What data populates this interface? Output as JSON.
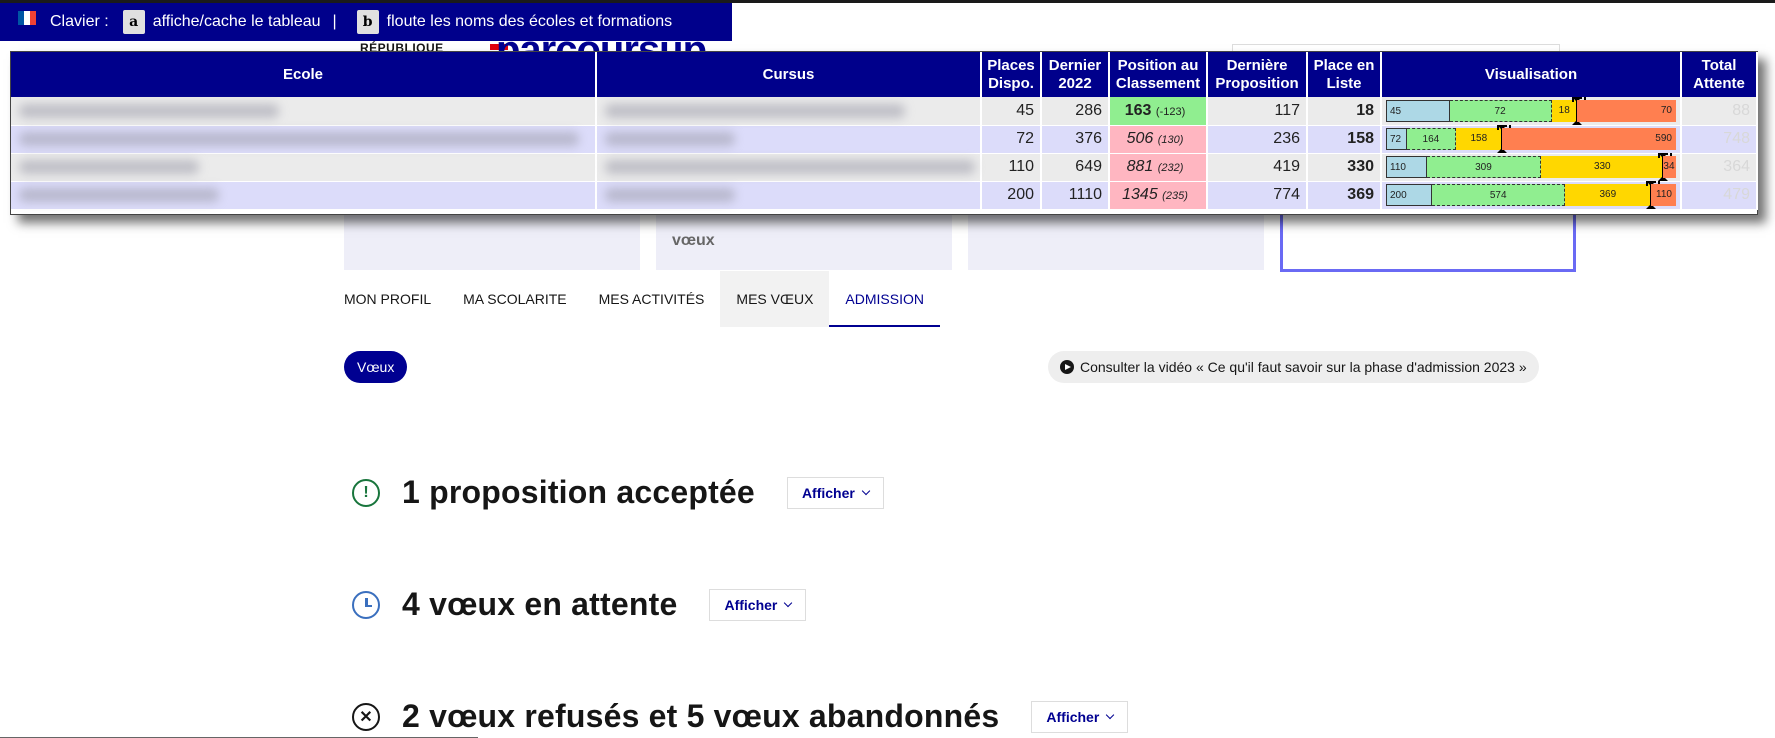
{
  "keyboard_bar": {
    "label": "Clavier :",
    "key_a": "a",
    "key_a_desc": "affiche/cache le tableau",
    "separator": "|",
    "key_b": "b",
    "key_b_desc": "floute les noms des écoles et formations"
  },
  "header": {
    "republique": "RÉPUBLIQUE",
    "logo": "parcoursup"
  },
  "table": {
    "columns": [
      "Ecole",
      "Cursus",
      "Places Dispo.",
      "Dernier 2022",
      "Position au Classement",
      "Dernière Proposition",
      "Place en Liste",
      "Visualisation",
      "Total Attente"
    ],
    "rows": [
      {
        "places": "45",
        "dernier": "286",
        "position": "163",
        "delta": "(-123)",
        "derniere_prop": "117",
        "place_liste": "18",
        "total": "88",
        "viz": [
          "45",
          "72",
          "18",
          "70"
        ]
      },
      {
        "places": "72",
        "dernier": "376",
        "position": "506",
        "delta": "(130)",
        "derniere_prop": "236",
        "place_liste": "158",
        "total": "748",
        "viz": [
          "72",
          "164",
          "158",
          "590"
        ]
      },
      {
        "places": "110",
        "dernier": "649",
        "position": "881",
        "delta": "(232)",
        "derniere_prop": "419",
        "place_liste": "330",
        "total": "364",
        "viz": [
          "110",
          "309",
          "330",
          "34"
        ]
      },
      {
        "places": "200",
        "dernier": "1110",
        "position": "1345",
        "delta": "(235)",
        "derniere_prop": "774",
        "place_liste": "369",
        "total": "479",
        "viz": [
          "200",
          "574",
          "369",
          "110"
        ]
      }
    ]
  },
  "cards": {
    "card2_text": "vœux"
  },
  "tabs": [
    "MON PROFIL",
    "MA SCOLARITE",
    "MES ACTIVITÉS",
    "MES VŒUX",
    "ADMISSION"
  ],
  "voeux_pill": "Vœux",
  "video_button": "Consulter la vidéo « Ce qu'il faut savoir sur la phase d'admission 2023 »",
  "sections": [
    {
      "title": "1 proposition acceptée",
      "button": "Afficher"
    },
    {
      "title": "4 vœux en attente",
      "button": "Afficher"
    },
    {
      "title": "2 vœux refusés et 5 vœux abandonnés",
      "button": "Afficher"
    }
  ],
  "colors": {
    "brand": "#000091",
    "header_bar": "#00008b",
    "viz_places": "#add8e6",
    "viz_ahead": "#90ee90",
    "viz_position": "#ffd700",
    "viz_behind": "#ff7f50",
    "pos_good": "#90ee90",
    "pos_bad": "#ffb6c1"
  }
}
